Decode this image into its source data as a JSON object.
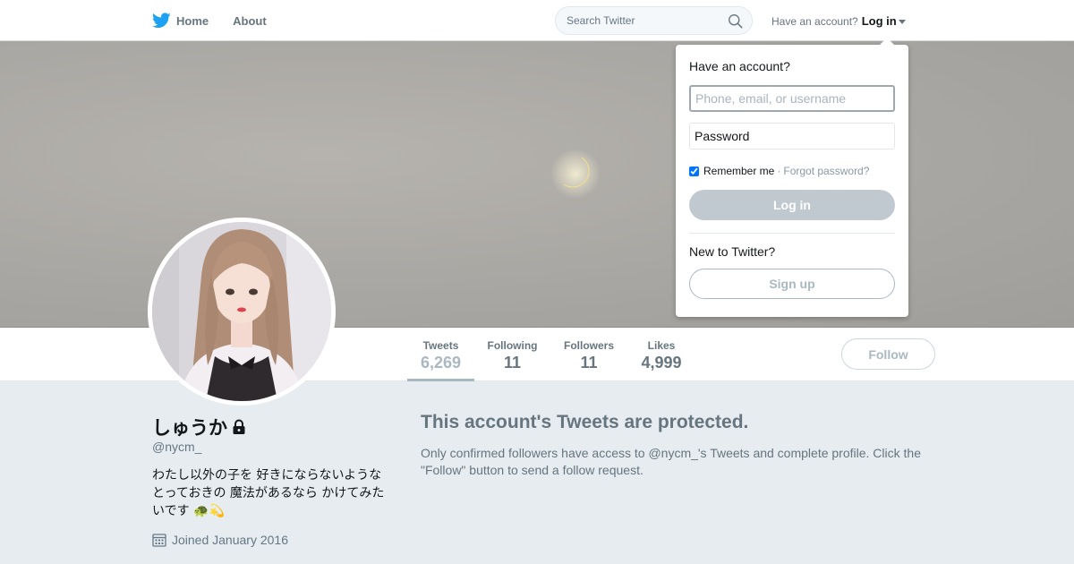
{
  "nav": {
    "home_label": "Home",
    "about_label": "About",
    "search_placeholder": "Search Twitter",
    "have_account": "Have an account?",
    "login_label": "Log in"
  },
  "profile": {
    "display_name": "しゅうか",
    "handle": "@nycm_",
    "bio": "わたし以外の子を 好きにならないような とっておきの 魔法があるなら かけてみたいです 🐢💫",
    "joined": "Joined January 2016",
    "follow_label": "Follow"
  },
  "stats": [
    {
      "label": "Tweets",
      "value": "6,269"
    },
    {
      "label": "Following",
      "value": "11"
    },
    {
      "label": "Followers",
      "value": "11"
    },
    {
      "label": "Likes",
      "value": "4,999"
    }
  ],
  "protected": {
    "title": "This account's Tweets are protected.",
    "text": "Only confirmed followers have access to @nycm_'s Tweets and complete profile. Click the \"Follow\" button to send a follow request."
  },
  "login_dropdown": {
    "heading": "Have an account?",
    "username_placeholder": "Phone, email, or username",
    "password_placeholder": "Password",
    "remember_label": "Remember me",
    "separator": "·",
    "forgot_label": "Forgot password?",
    "login_button": "Log in",
    "new_label": "New to Twitter?",
    "signup_button": "Sign up",
    "remember_checked": true
  },
  "colors": {
    "brand": "#1da1f2",
    "muted": "#66757f",
    "page_bg": "#e6ecf0"
  },
  "icons": [
    "twitter-bird-icon",
    "search-icon",
    "caret-down-icon",
    "lock-icon",
    "calendar-icon"
  ]
}
